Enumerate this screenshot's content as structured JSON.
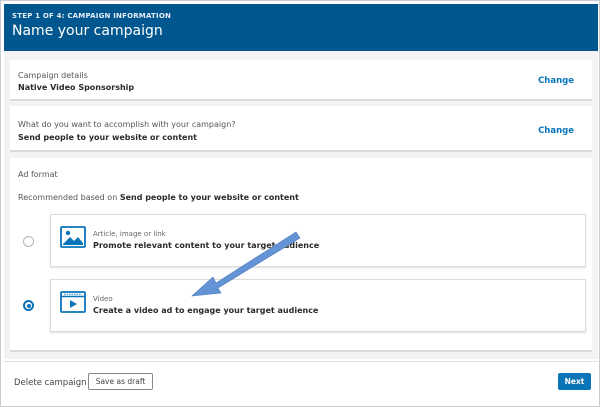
{
  "header": {
    "step_label": "STEP 1 OF 4: CAMPAIGN INFORMATION",
    "title": "Name your campaign",
    "background_color": "#00578f"
  },
  "campaign_details": {
    "label": "Campaign details",
    "value": "Native Video Sponsorship",
    "change_label": "Change"
  },
  "objective": {
    "label": "What do you want to accomplish with your campaign?",
    "value": "Send people to your website or content",
    "change_label": "Change"
  },
  "ad_format": {
    "label": "Ad format",
    "recommended_prefix": "Recommended based on ",
    "recommended_value": "Send people to your website or content",
    "options": [
      {
        "title": "Article, image or link",
        "description": "Promote relevant content to your target audience",
        "icon": "image-icon",
        "selected": false
      },
      {
        "title": "Video",
        "description": "Create a video ad to engage your target audience",
        "icon": "video-icon",
        "selected": true
      }
    ]
  },
  "footer": {
    "delete_label": "Delete campaign",
    "draft_label": "Save as draft",
    "next_label": "Next"
  },
  "colors": {
    "accent": "#0a74b8",
    "annotation_arrow": "#5b8fd4"
  }
}
